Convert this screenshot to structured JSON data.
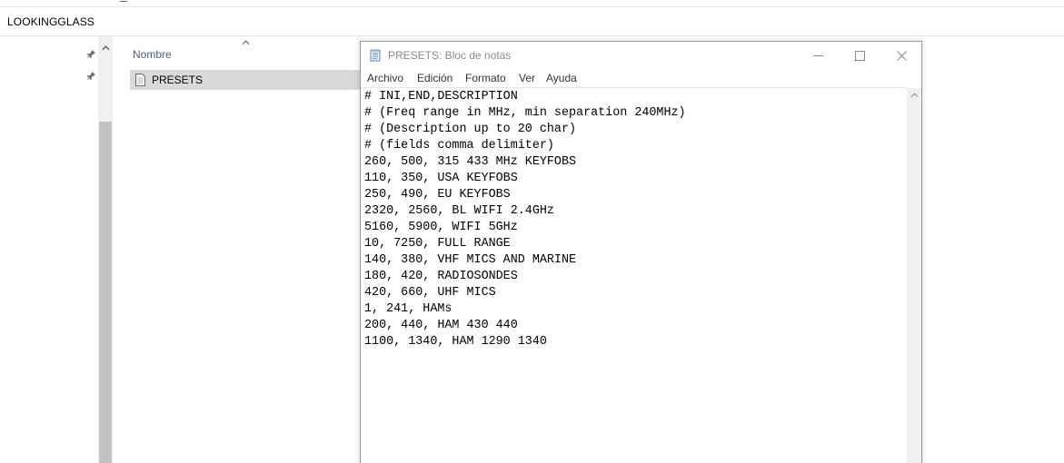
{
  "explorer": {
    "address": "LOOKINGGLASS",
    "column_header": "Nombre",
    "files": [
      {
        "name": "PRESETS",
        "icon": "text-file-icon"
      }
    ]
  },
  "notepad": {
    "title": "PRESETS: Bloc de notas",
    "menu": [
      "Archivo",
      "Edición",
      "Formato",
      "Ver",
      "Ayuda"
    ],
    "lines": [
      "# INI,END,DESCRIPTION",
      "# (Freq range in MHz, min separation 240MHz)",
      "# (Description up to 20 char)",
      "# (fields comma delimiter)",
      "260, 500, 315 433 MHz KEYFOBS",
      "110, 350, USA KEYFOBS",
      "250, 490, EU KEYFOBS",
      "2320, 2560, BL WIFI 2.4GHz",
      "5160, 5900, WIFI 5GHz",
      "10, 7250, FULL RANGE",
      "140, 380, VHF MICS AND MARINE",
      "180, 420, RADIOSONDES",
      "420, 660, UHF MICS",
      "1, 241, HAMs",
      "200, 440, HAM 430 440",
      "1100, 1340, HAM 1290 1340"
    ]
  },
  "colors": {
    "header_text": "#4c607a",
    "selected_row": "#d9d9d9",
    "scroll_thumb": "#c2c2c2",
    "title_gray": "#8a8a8a"
  }
}
